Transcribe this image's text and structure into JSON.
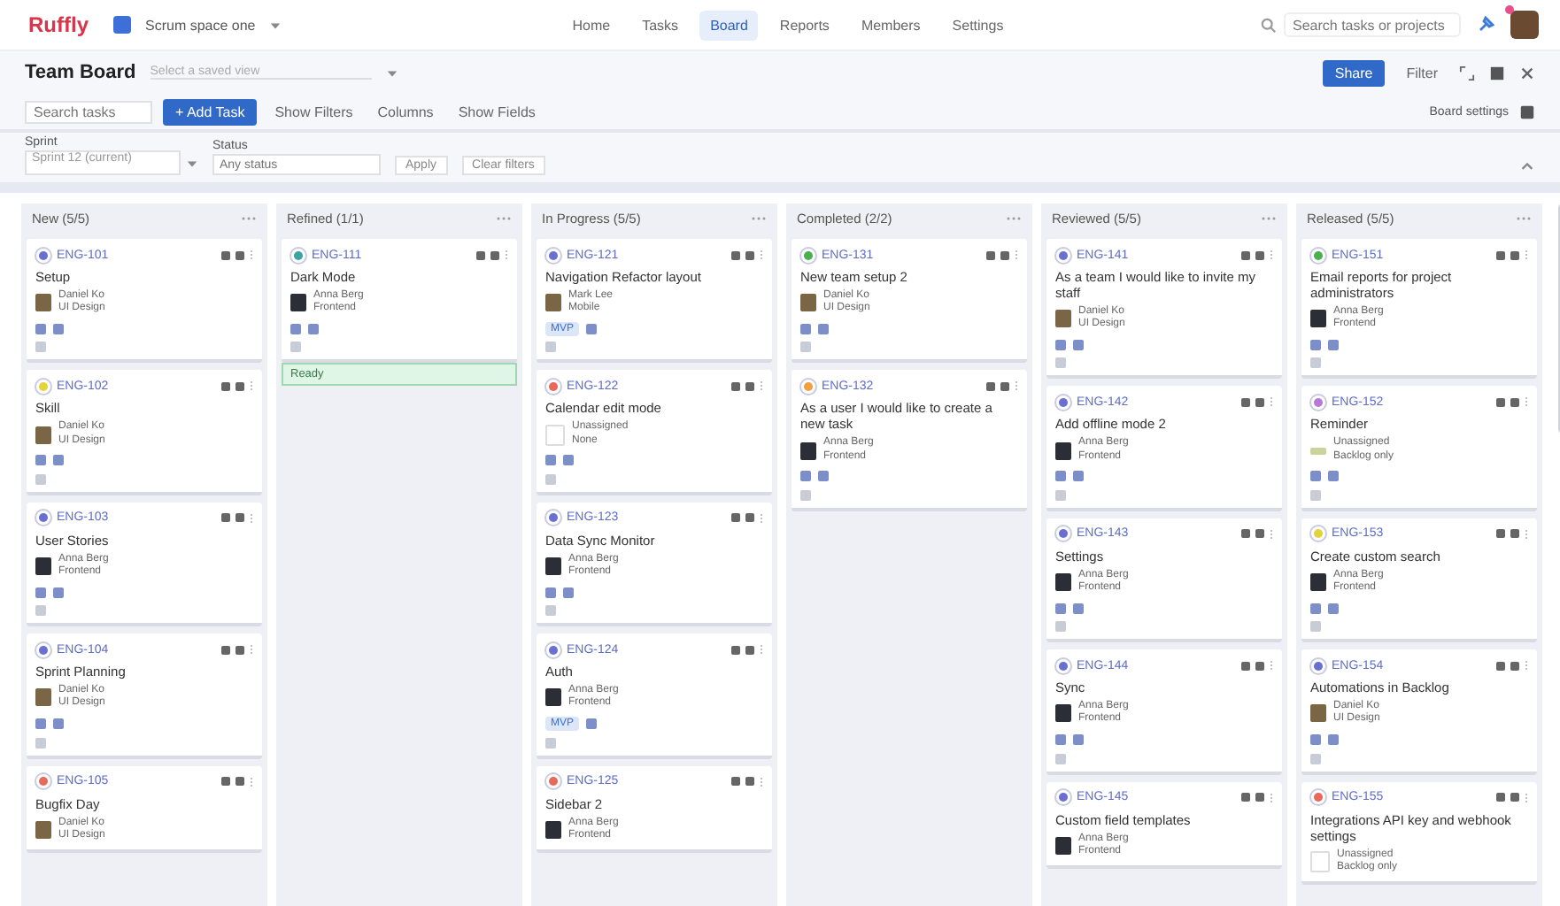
{
  "nav": {
    "logo": "Ruffly",
    "project": "Scrum space one",
    "tabs": [
      {
        "label": "Home",
        "selected": false
      },
      {
        "label": "Tasks",
        "selected": false
      },
      {
        "label": "Board",
        "selected": true
      },
      {
        "label": "Reports",
        "selected": false
      },
      {
        "label": "Members",
        "selected": false
      },
      {
        "label": "Settings",
        "selected": false
      }
    ],
    "search": {
      "placeholder": "Search tasks or projects"
    },
    "notifications": true
  },
  "header": {
    "title": "Team Board",
    "view_select": "Select a saved view",
    "share": "Share",
    "filter": "Filter"
  },
  "toolbar": {
    "search": {
      "placeholder": "Search tasks"
    },
    "add": "+ Add Task",
    "show_filters": "Show Filters",
    "columns": "Columns",
    "show_fields": "Show Fields",
    "settings": "Board settings"
  },
  "filters": {
    "sprint_label": "Sprint",
    "sprint_value": "Sprint 12 (current)",
    "status_label": "Status",
    "status_placeholder": "Any status",
    "apply": "Apply",
    "clear": "Clear filters"
  },
  "columns": [
    {
      "name": "New",
      "count": "(5/5)",
      "cards": [
        {
          "id": "ENG-101",
          "title": "Setup",
          "color": "#6b6fd4",
          "assignee": {
            "name": "Daniel Ko",
            "role": "UI Design",
            "kind": "photo"
          }
        },
        {
          "id": "ENG-102",
          "title": "Skill",
          "color": "#e2d43a",
          "assignee": {
            "name": "Daniel Ko",
            "role": "UI Design",
            "kind": "photo"
          }
        },
        {
          "id": "ENG-103",
          "title": "User Stories",
          "color": "#6b6fd4",
          "assignee": {
            "name": "Anna Berg",
            "role": "Frontend",
            "kind": "dark"
          }
        },
        {
          "id": "ENG-104",
          "title": "Sprint Planning",
          "color": "#6b6fd4",
          "assignee": {
            "name": "Daniel Ko",
            "role": "UI Design",
            "kind": "photo"
          }
        },
        {
          "id": "ENG-105",
          "title": "Bugfix Day",
          "color": "#e8685a",
          "kind": "partial",
          "assignee": {
            "name": "Daniel Ko",
            "role": "UI Design",
            "kind": "photo"
          }
        }
      ]
    },
    {
      "name": "Refined",
      "count": "(1/1)",
      "ready": "Ready",
      "cards": [
        {
          "id": "ENG-111",
          "title": "Dark Mode",
          "color": "#3aa3a3",
          "assignee": {
            "name": "Anna Berg",
            "role": "Frontend",
            "kind": "dark"
          }
        }
      ]
    },
    {
      "name": "In Progress",
      "count": "(5/5)",
      "cards": [
        {
          "id": "ENG-121",
          "title": "Navigation Refactor layout",
          "color": "#6b6fd4",
          "label": "MVP",
          "assignee": {
            "name": "Mark Lee",
            "role": "Mobile",
            "kind": "photo"
          }
        },
        {
          "id": "ENG-122",
          "title": "Calendar edit mode",
          "color": "#e8685a",
          "assignee": {
            "name": "Unassigned",
            "role": "None",
            "kind": "empty"
          }
        },
        {
          "id": "ENG-123",
          "title": "Data Sync Monitor",
          "color": "#6b6fd4",
          "assignee": {
            "name": "Anna Berg",
            "role": "Frontend",
            "kind": "dark"
          }
        },
        {
          "id": "ENG-124",
          "title": "Auth",
          "color": "#6b6fd4",
          "label": "MVP",
          "assignee": {
            "name": "Anna Berg",
            "role": "Frontend",
            "kind": "dark"
          }
        },
        {
          "id": "ENG-125",
          "title": "Sidebar 2",
          "color": "#e8685a",
          "kind": "partial",
          "assignee": {
            "name": "Anna Berg",
            "role": "Frontend",
            "kind": "dark"
          }
        }
      ]
    },
    {
      "name": "Completed",
      "count": "(2/2)",
      "cards": [
        {
          "id": "ENG-131",
          "title": "New team setup 2",
          "color": "#4caf50",
          "assignee": {
            "name": "Daniel Ko",
            "role": "UI Design",
            "kind": "photo"
          }
        },
        {
          "id": "ENG-132",
          "title": "As a user I would like to create a new task",
          "color": "#f0a040",
          "assignee": {
            "name": "Anna Berg",
            "role": "Frontend",
            "kind": "dark"
          }
        }
      ]
    },
    {
      "name": "Reviewed",
      "count": "(5/5)",
      "cards": [
        {
          "id": "ENG-141",
          "title": "As a team I would like to invite my staff",
          "color": "#6b6fd4",
          "assignee": {
            "name": "Daniel Ko",
            "role": "UI Design",
            "kind": "photo"
          }
        },
        {
          "id": "ENG-142",
          "title": "Add offline mode 2",
          "color": "#6b6fd4",
          "assignee": {
            "name": "Anna Berg",
            "role": "Frontend",
            "kind": "dark"
          }
        },
        {
          "id": "ENG-143",
          "title": "Settings",
          "color": "#6b6fd4",
          "assignee": {
            "name": "Anna Berg",
            "role": "Frontend",
            "kind": "dark"
          }
        },
        {
          "id": "ENG-144",
          "title": "Sync",
          "color": "#6b6fd4",
          "assignee": {
            "name": "Anna Berg",
            "role": "Frontend",
            "kind": "dark"
          }
        },
        {
          "id": "ENG-145",
          "title": "Custom field templates",
          "color": "#6b6fd4",
          "kind": "partial",
          "assignee": {
            "name": "Anna Berg",
            "role": "Frontend",
            "kind": "dark"
          }
        }
      ]
    },
    {
      "name": "Released",
      "count": "(5/5)",
      "cards": [
        {
          "id": "ENG-151",
          "title": "Email reports for project administrators",
          "color": "#4caf50",
          "assignee": {
            "name": "Anna Berg",
            "role": "Frontend",
            "kind": "dark"
          }
        },
        {
          "id": "ENG-152",
          "title": "Reminder",
          "color": "#b57ad9",
          "assignee": {
            "name": "Unassigned",
            "role": "Backlog only",
            "kind": "leaf"
          }
        },
        {
          "id": "ENG-153",
          "title": "Create custom search",
          "color": "#e2d43a",
          "assignee": {
            "name": "Anna Berg",
            "role": "Frontend",
            "kind": "dark"
          }
        },
        {
          "id": "ENG-154",
          "title": "Automations in Backlog",
          "color": "#6b6fd4",
          "assignee": {
            "name": "Daniel Ko",
            "role": "UI Design",
            "kind": "photo"
          }
        },
        {
          "id": "ENG-155",
          "title": "Integrations API key and webhook settings",
          "color": "#e8685a",
          "kind": "partial",
          "assignee": {
            "name": "Unassigned",
            "role": "Backlog only",
            "kind": "empty"
          }
        }
      ]
    }
  ]
}
